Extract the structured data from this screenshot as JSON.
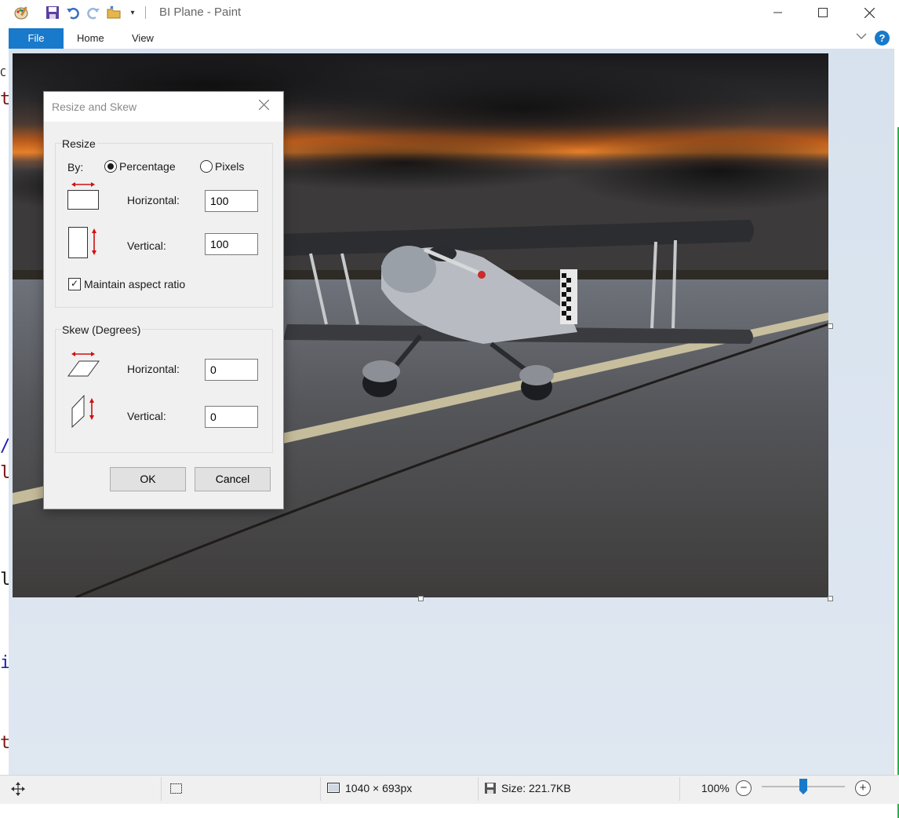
{
  "window": {
    "title": "BI Plane - Paint",
    "controls": [
      "minimize",
      "maximize",
      "close"
    ]
  },
  "ribbon": {
    "file": "File",
    "tabs": [
      "Home",
      "View"
    ],
    "help": "?"
  },
  "dialog": {
    "title": "Resize and Skew",
    "resize": {
      "group_label": "Resize",
      "by_label": "By:",
      "percentage_label": "Percentage",
      "pixels_label": "Pixels",
      "selected_mode": "Percentage",
      "horizontal_label": "Horizontal:",
      "horizontal_value": "100",
      "vertical_label": "Vertical:",
      "vertical_value": "100",
      "maintain_aspect_label": "Maintain aspect ratio",
      "maintain_aspect_checked": true
    },
    "skew": {
      "group_label": "Skew (Degrees)",
      "horizontal_label": "Horizontal:",
      "horizontal_value": "0",
      "vertical_label": "Vertical:",
      "vertical_value": "0"
    },
    "ok_label": "OK",
    "cancel_label": "Cancel"
  },
  "statusbar": {
    "dimensions": "1040 × 693px",
    "size": "Size: 221.7KB",
    "zoom": "100%",
    "zoom_level": 1.0
  },
  "colors": {
    "accent": "#1979ca",
    "arrow_red": "#d01010",
    "workspace": "#d9e3ef"
  },
  "background_editor": {
    "chars": [
      "C",
      "t",
      "/",
      "l",
      "l",
      "i",
      "t"
    ]
  }
}
